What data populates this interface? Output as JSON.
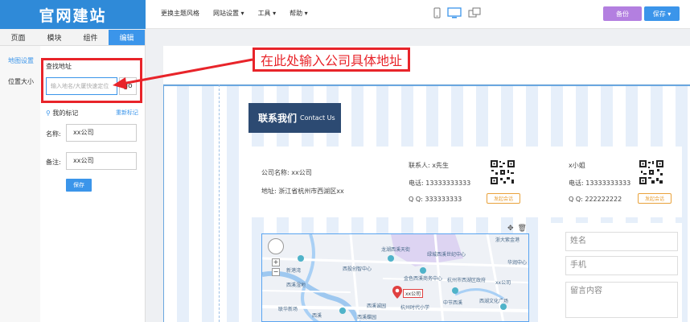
{
  "header": {
    "logo": "官网建站",
    "nav": [
      "更换主题风格",
      "网站设置 ▾",
      "工具 ▾",
      "帮助 ▾"
    ],
    "backup_label": "备份",
    "save_label": "保存 ▾"
  },
  "left_panel": {
    "tabs": [
      "页面",
      "模块",
      "组件",
      "编辑"
    ],
    "active_tab": "编辑",
    "side_items": [
      "地图设置",
      "位置大小"
    ],
    "find_label": "查找地址",
    "address_placeholder": "输入地名/大厦快速定位",
    "go_label": "go",
    "mark_label": "我的标记",
    "reset_label": "重新标记",
    "name_label": "名称:",
    "name_value": "xx公司",
    "note_label": "备注:",
    "note_value": "xx公司",
    "save_label": "保存"
  },
  "annotation": {
    "callout": "在此处输入公司具体地址",
    "color": "#e8242a"
  },
  "contact": {
    "title_zh": "联系我们",
    "title_en": "Contact Us",
    "company_line": "公司名称: xx公司",
    "address_line": "地址: 浙江省杭州市西湖区xx",
    "person1": {
      "contact": "联系人: x先生",
      "phone": "电话: 13333333333",
      "qq": "Q Q: 333333333",
      "button": "发起会话"
    },
    "person2": {
      "contact": "x小姐",
      "phone": "电话: 13333333333",
      "qq": "Q Q: 222222222",
      "button": "发起会话"
    }
  },
  "map": {
    "labels": [
      "浙大紫金港",
      "龙湖西溪天街",
      "绿城西溪世纪中心",
      "西投创智中心",
      "金色西溪商务中心",
      "西溪诚园",
      "西溪蝶园",
      "杭州时代小学",
      "中节西溪",
      "西湖文化广场",
      "杭州市西湖区政府",
      "西溪湿地",
      "华润中心",
      "xx公司",
      "联华新场",
      "新港湾",
      "西溪"
    ],
    "marker_label": "xx公司"
  },
  "message_form": {
    "name_placeholder": "姓名",
    "phone_placeholder": "手机",
    "message_placeholder": "留言内容"
  },
  "colors": {
    "accent": "#3b95ea",
    "title_bg": "#2c4a72",
    "backup": "#b37fe0",
    "consult": "#e9a23b"
  }
}
